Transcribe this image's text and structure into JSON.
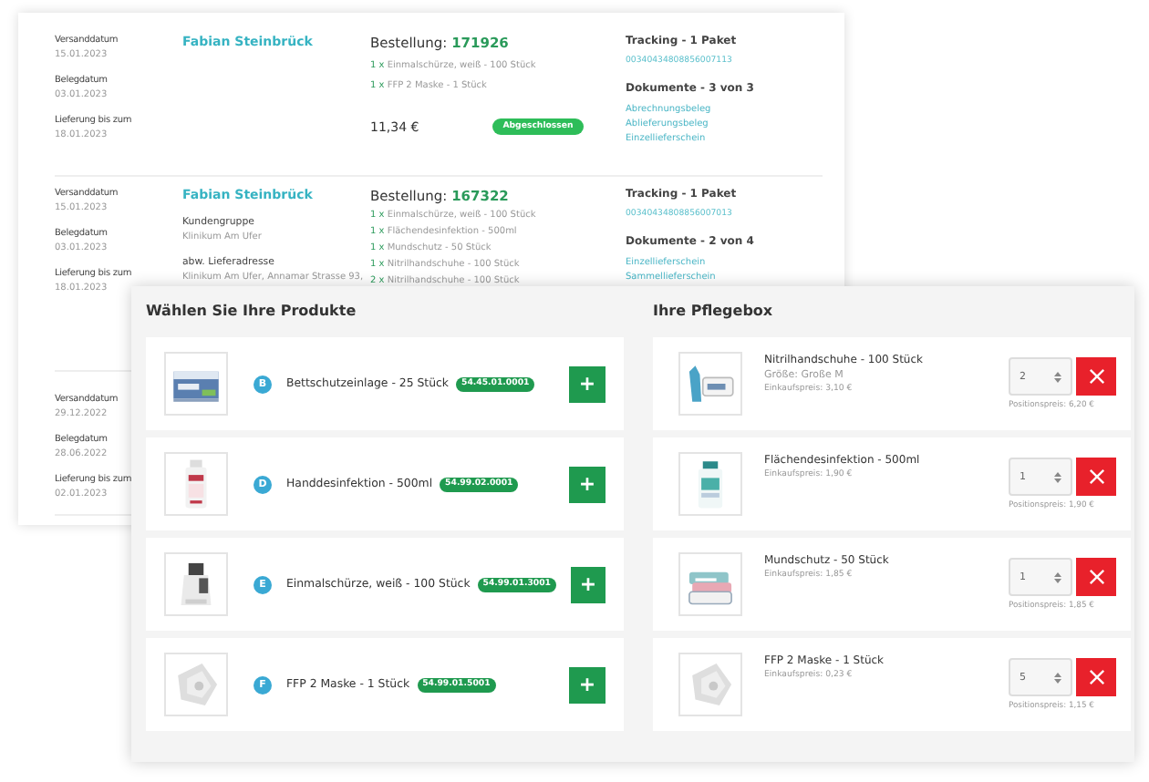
{
  "orders_window": {
    "orders": [
      {
        "dates": [
          {
            "label": "Versanddatum",
            "value": "15.01.2023"
          },
          {
            "label": "Belegdatum",
            "value": "03.01.2023"
          },
          {
            "label": "Lieferung bis zum",
            "value": "18.01.2023"
          }
        ],
        "customer": "Fabian Steinbrück",
        "order_label": "Bestellung:",
        "order_number": "171926",
        "items": [
          {
            "qty": "1 x",
            "text": "Einmalschürze, weiß - 100 Stück"
          },
          {
            "qty": "1 x",
            "text": "FFP 2 Maske - 1 Stück"
          }
        ],
        "total": "11,34 €",
        "status": "Abgeschlossen",
        "tracking_title": "Tracking - 1 Paket",
        "tracking_number": "00340434808856007113",
        "documents_title": "Dokumente - 3 von 3",
        "documents": [
          "Abrechnungsbeleg",
          "Ablieferungsbeleg",
          "Einzellieferschein"
        ]
      },
      {
        "dates": [
          {
            "label": "Versanddatum",
            "value": "15.01.2023"
          },
          {
            "label": "Belegdatum",
            "value": "03.01.2023"
          },
          {
            "label": "Lieferung bis zum",
            "value": "18.01.2023"
          }
        ],
        "customer": "Fabian Steinbrück",
        "customer_group_label": "Kundengruppe",
        "customer_group": "Klinikum Am Ufer",
        "address_label": "abw. Lieferadresse",
        "address": "Klinikum Am Ufer, Annamar Strasse 93,",
        "order_label": "Bestellung:",
        "order_number": "167322",
        "items": [
          {
            "qty": "1 x",
            "text": "Einmalschürze, weiß - 100 Stück"
          },
          {
            "qty": "1 x",
            "text": "Flächendesinfektion - 500ml"
          },
          {
            "qty": "1 x",
            "text": "Mundschutz - 50 Stück"
          },
          {
            "qty": "1 x",
            "text": "Nitrilhandschuhe - 100 Stück"
          },
          {
            "qty": "2 x",
            "text": "Nitrilhandschuhe - 100 Stück"
          }
        ],
        "tracking_title": "Tracking - 1 Paket",
        "tracking_number": "00340434808856007013",
        "documents_title": "Dokumente - 2 von 4",
        "documents": [
          "Einzellieferschein",
          "Sammellieferschein"
        ]
      },
      {
        "dates": [
          {
            "label": "Versanddatum",
            "value": "29.12.2022"
          },
          {
            "label": "Belegdatum",
            "value": "28.06.2022"
          },
          {
            "label": "Lieferung bis zum",
            "value": "02.01.2023"
          }
        ]
      }
    ]
  },
  "shop_window": {
    "products_title": "Wählen Sie Ihre Produkte",
    "products": [
      {
        "letter": "B",
        "name": "Bettschutzeinlage - 25 Stück",
        "code": "54.45.01.0001",
        "button": "+"
      },
      {
        "letter": "D",
        "name": "Handdesinfektion - 500ml",
        "code": "54.99.02.0001",
        "button": "+"
      },
      {
        "letter": "E",
        "name": "Einmalschürze, weiß - 100 Stück",
        "code": "54.99.01.3001",
        "button": "+"
      },
      {
        "letter": "F",
        "name": "FFP 2 Maske - 1 Stück",
        "code": "54.99.01.5001",
        "button": "+"
      }
    ],
    "box_title": "Ihre Pflegebox",
    "box_items": [
      {
        "name": "Nitrilhandschuhe - 100 Stück",
        "size": "Größe: Große M",
        "price": "Einkaufspreis: 3,10 €",
        "quantity": "2",
        "total": "Positionspreis: 6,20 €"
      },
      {
        "name": "Flächendesinfektion - 500ml",
        "price": "Einkaufspreis: 1,90 €",
        "quantity": "1",
        "total": "Positionspreis: 1,90 €"
      },
      {
        "name": "Mundschutz - 50 Stück",
        "price": "Einkaufspreis: 1,85 €",
        "quantity": "1",
        "total": "Positionspreis: 1,85 €"
      },
      {
        "name": "FFP 2 Maske - 1 Stück",
        "price": "Einkaufspreis: 0,23 €",
        "quantity": "5",
        "total": "Positionspreis: 1,15 €"
      }
    ]
  }
}
